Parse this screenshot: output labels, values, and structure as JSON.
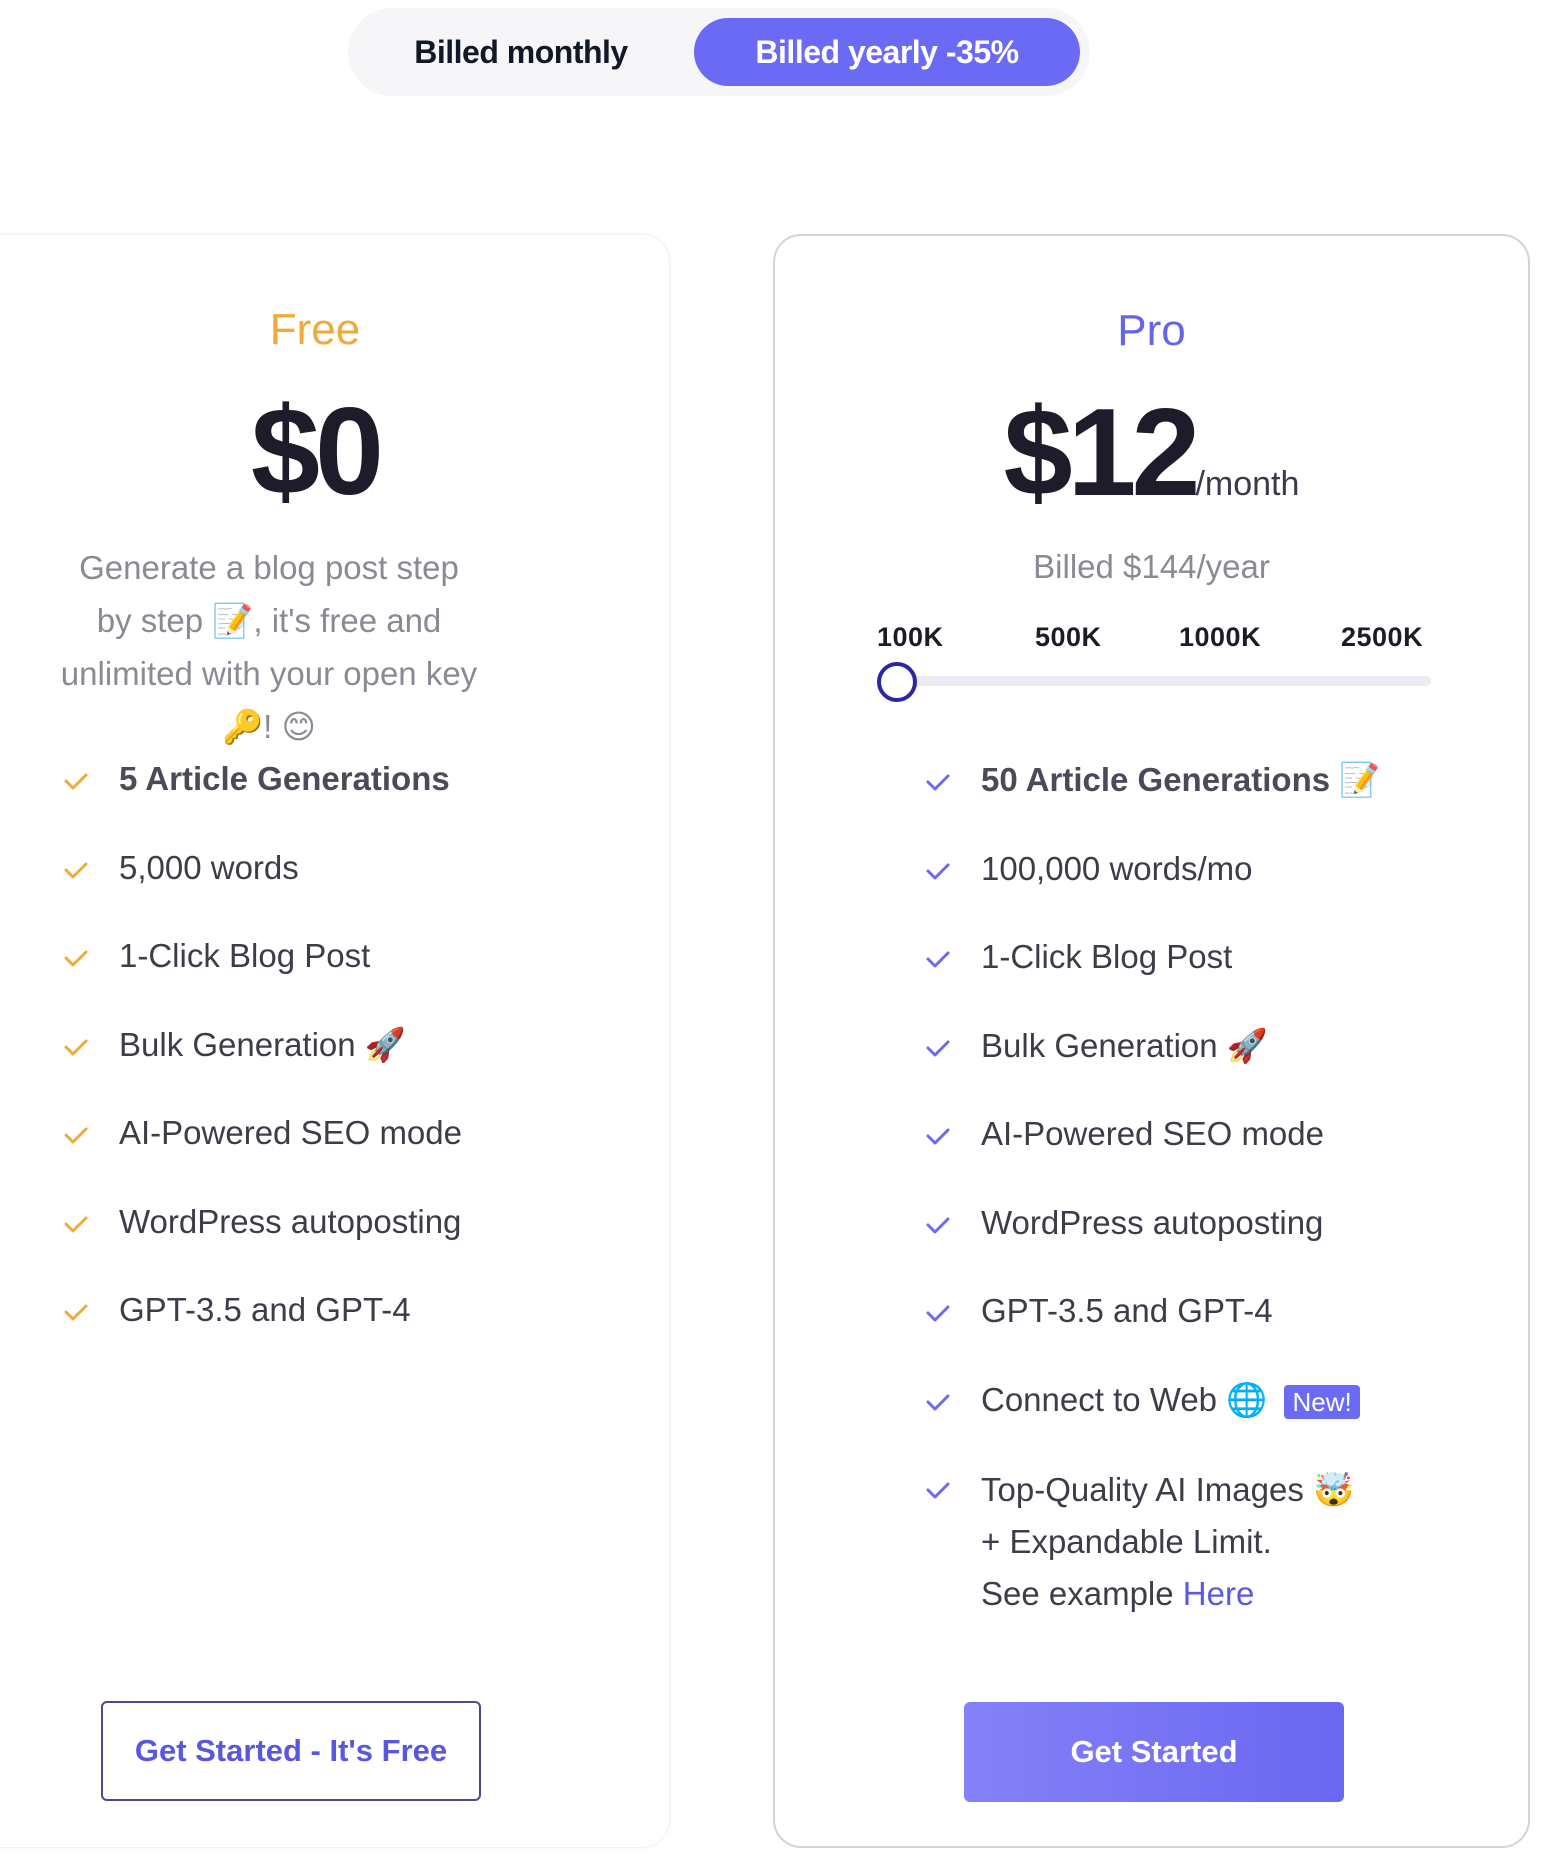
{
  "toggle": {
    "monthly_label": "Billed monthly",
    "yearly_label": "Billed yearly -35%",
    "selected": "yearly"
  },
  "plans": {
    "free": {
      "name": "Free",
      "price": "$0",
      "description": "Generate a blog post step by step 📝, it's free and unlimited with your open key 🔑! 😊",
      "features": [
        "5 Article Generations",
        "5,000 words",
        "1-Click Blog Post",
        "Bulk Generation 🚀",
        "AI-Powered SEO mode",
        "WordPress autoposting",
        "GPT-3.5 and GPT-4"
      ],
      "cta": "Get Started - It's Free"
    },
    "pro": {
      "name": "Pro",
      "price": "$12",
      "price_suffix": "/month",
      "billed_note": "Billed $144/year",
      "slider": {
        "ticks": [
          "100K",
          "500K",
          "1000K",
          "2500K"
        ],
        "selected": "100K"
      },
      "features": [
        "50 Article Generations 📝",
        "100,000 words/mo",
        "1-Click Blog Post",
        "Bulk Generation 🚀",
        "AI-Powered SEO mode",
        "WordPress autoposting",
        "GPT-3.5 and GPT-4",
        "Connect to Web 🌐"
      ],
      "new_badge": "New!",
      "images_feature": {
        "line1": "Top-Quality AI Images 🤯",
        "line2": "+ Expandable Limit.",
        "line3_prefix": "See example ",
        "line3_link": "Here"
      },
      "cta": "Get Started"
    }
  },
  "colors": {
    "accent": "#6b6af5",
    "free_accent": "#f2a93b",
    "pro_name": "#6764e8"
  }
}
